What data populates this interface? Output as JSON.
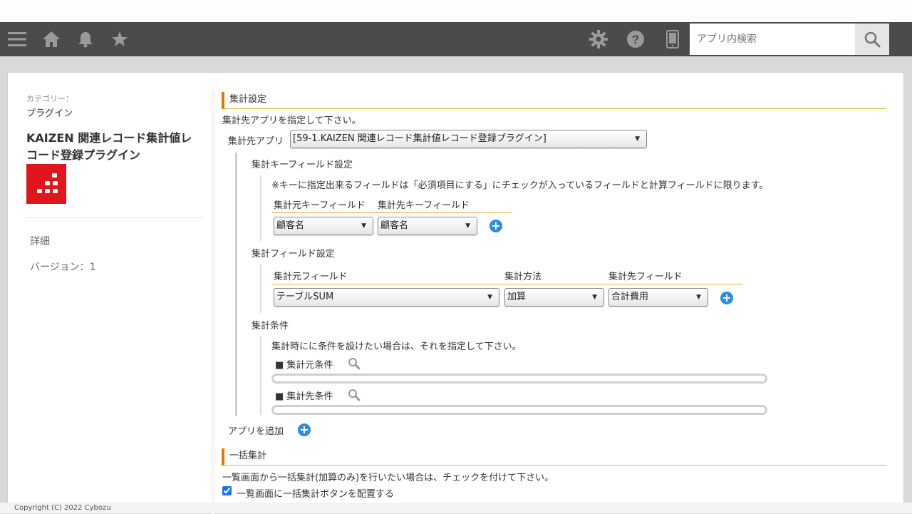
{
  "header": {
    "menu_icon": "hamburger-icon",
    "home_icon": "home-icon",
    "notification_icon": "bell-icon",
    "favorites_icon": "star-icon",
    "settings_icon": "gear-icon",
    "help_icon": "question-icon",
    "mobile_icon": "mobile-icon",
    "search_placeholder": "アプリ内検索",
    "search_icon": "search-icon"
  },
  "sidebar": {
    "category_label": "カテゴリー：",
    "category_value": "プラグイン",
    "plugin_name": "KAIZEN 関連レコード集計値レコード登録プラグイン",
    "details_link": "詳細",
    "version": "バージョン：1",
    "logo_color": "#e0161e"
  },
  "settings": {
    "section_title": "集計設定",
    "description": "集計先アプリを指定して下さい。",
    "target_app_label": "集計先アプリ",
    "target_app_value": "[59-1.KAIZEN 関連レコード集計値レコード登録プラグイン]",
    "key_field": {
      "title": "集計キーフィールド設定",
      "note": "※キーに指定出来るフィールドは「必須項目にする」にチェックが入っているフィールドと計算フィールドに限ります。",
      "col_source": "集計元キーフィールド",
      "col_target": "集計先キーフィールド",
      "source_value": "顧客名",
      "target_value": "顧客名"
    },
    "agg_field": {
      "title": "集計フィールド設定",
      "col_source": "集計元フィールド",
      "col_method": "集計方法",
      "col_target": "集計先フィールド",
      "source_value": "テーブルSUM",
      "method_value": "加算",
      "target_value": "合計費用"
    },
    "condition": {
      "title": "集計条件",
      "description": "集計時にに条件を設けたい場合は、それを指定して下さい。",
      "source_label": "■ 集計元条件",
      "target_label": "■ 集計先条件"
    },
    "add_app_label": "アプリを追加"
  },
  "bulk": {
    "section_title": "一括集計",
    "description": "一覧画面から一括集計(加算のみ)を行いたい場合は、チェックを付けて下さい。",
    "checkbox_label": "一覧画面に一括集計ボタンを配置する",
    "checked": true
  },
  "footer": {
    "copyright": "Copyright (C) 2022 Cybozu"
  },
  "colors": {
    "header_bg": "#4b4b4b",
    "accent_orange": "#e07b00",
    "accent_gold": "#e3b42f",
    "add_button": "#2d8be0"
  }
}
